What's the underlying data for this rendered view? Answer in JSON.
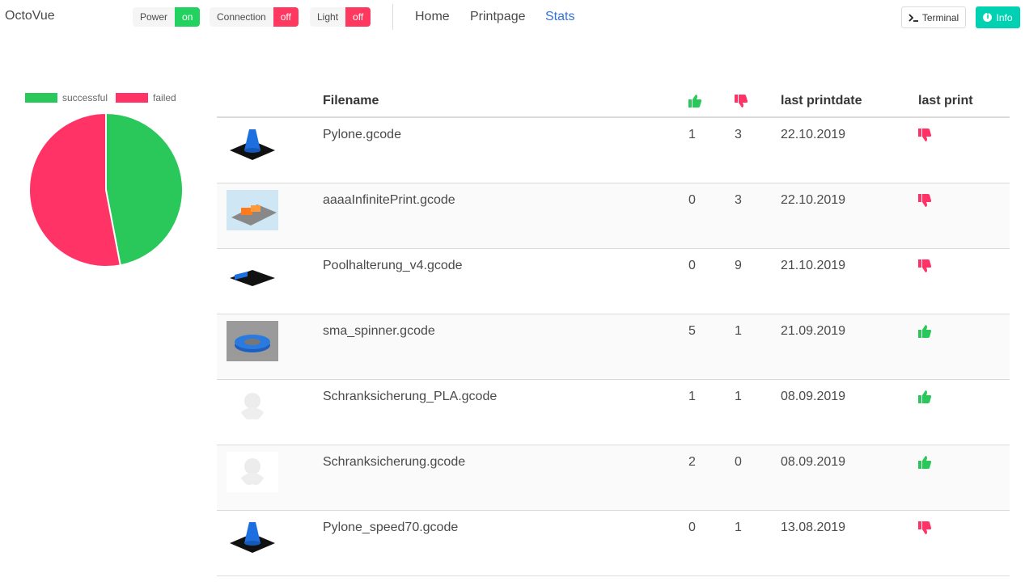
{
  "app": {
    "brand": "OctoVue"
  },
  "status": [
    {
      "label": "Power",
      "value": "on",
      "state": "on"
    },
    {
      "label": "Connection",
      "value": "off",
      "state": "off"
    },
    {
      "label": "Light",
      "value": "off",
      "state": "off"
    }
  ],
  "nav": {
    "home": "Home",
    "printpage": "Printpage",
    "stats": "Stats"
  },
  "buttons": {
    "terminal": "Terminal",
    "info": "Info"
  },
  "colors": {
    "success": "#2ac75a",
    "fail": "#ff3366",
    "accent": "#3273dc",
    "teal": "#00d1b2"
  },
  "chart": {
    "type": "pie",
    "legend": [
      {
        "label": "successful",
        "color": "#2ac75a"
      },
      {
        "label": "failed",
        "color": "#ff3366"
      }
    ],
    "chart_data": {
      "type": "pie",
      "categories": [
        "successful",
        "failed"
      ],
      "values": [
        47,
        53
      ]
    }
  },
  "table": {
    "headers": {
      "filename": "Filename",
      "success_icon": "thumbs-up-icon",
      "fail_icon": "thumbs-down-icon",
      "lastdate": "last printdate",
      "lastprint": "last print"
    },
    "rows": [
      {
        "filename": "Pylone.gcode",
        "success": "1",
        "fail": "3",
        "date": "22.10.2019",
        "last": "fail",
        "thumb": "cone"
      },
      {
        "filename": "aaaaInfinitePrint.gcode",
        "success": "0",
        "fail": "3",
        "date": "22.10.2019",
        "last": "fail",
        "thumb": "infinite"
      },
      {
        "filename": "Poolhalterung_v4.gcode",
        "success": "0",
        "fail": "9",
        "date": "21.10.2019",
        "last": "fail",
        "thumb": "pool"
      },
      {
        "filename": "sma_spinner.gcode",
        "success": "5",
        "fail": "1",
        "date": "21.09.2019",
        "last": "success",
        "thumb": "spinner"
      },
      {
        "filename": "Schranksicherung_PLA.gcode",
        "success": "1",
        "fail": "1",
        "date": "08.09.2019",
        "last": "success",
        "thumb": "octopus"
      },
      {
        "filename": "Schranksicherung.gcode",
        "success": "2",
        "fail": "0",
        "date": "08.09.2019",
        "last": "success",
        "thumb": "octopus"
      },
      {
        "filename": "Pylone_speed70.gcode",
        "success": "0",
        "fail": "1",
        "date": "13.08.2019",
        "last": "fail",
        "thumb": "cone"
      }
    ]
  }
}
